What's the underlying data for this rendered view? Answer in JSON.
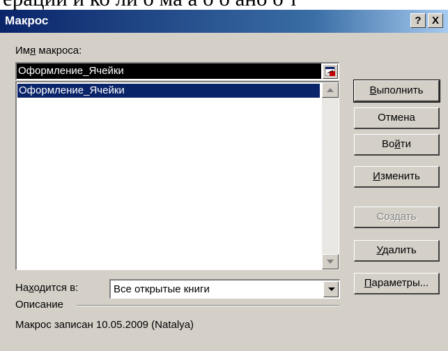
{
  "background_text": "ерации и ко ли о ма а о о ано о т",
  "dialog": {
    "title": "Макрос",
    "help_button": "?",
    "close_button": "X"
  },
  "macro_name": {
    "label_pre": "Им",
    "label_ul": "я",
    "label_post": " макроса:",
    "value": "Оформление_Ячейки"
  },
  "macro_list": {
    "items": [
      "Оформление_Ячейки"
    ]
  },
  "buttons": {
    "run": {
      "ul": "В",
      "rest": "ыполнить"
    },
    "cancel": {
      "text": "Отмена"
    },
    "step_pre": "Во",
    "step_ul": "й",
    "step_post": "ти",
    "edit": {
      "ul": "И",
      "rest": "зменить"
    },
    "create": {
      "text": "Создать"
    },
    "delete": {
      "ul": "У",
      "rest": "далить"
    },
    "options": {
      "ul": "П",
      "rest": "араметры..."
    }
  },
  "location": {
    "label_pre": "На",
    "label_ul": "х",
    "label_post": "одится в:",
    "value": "Все открытые книги"
  },
  "description": {
    "label": "Описание",
    "text": "Макрос записан 10.05.2009 (Natalya)"
  }
}
